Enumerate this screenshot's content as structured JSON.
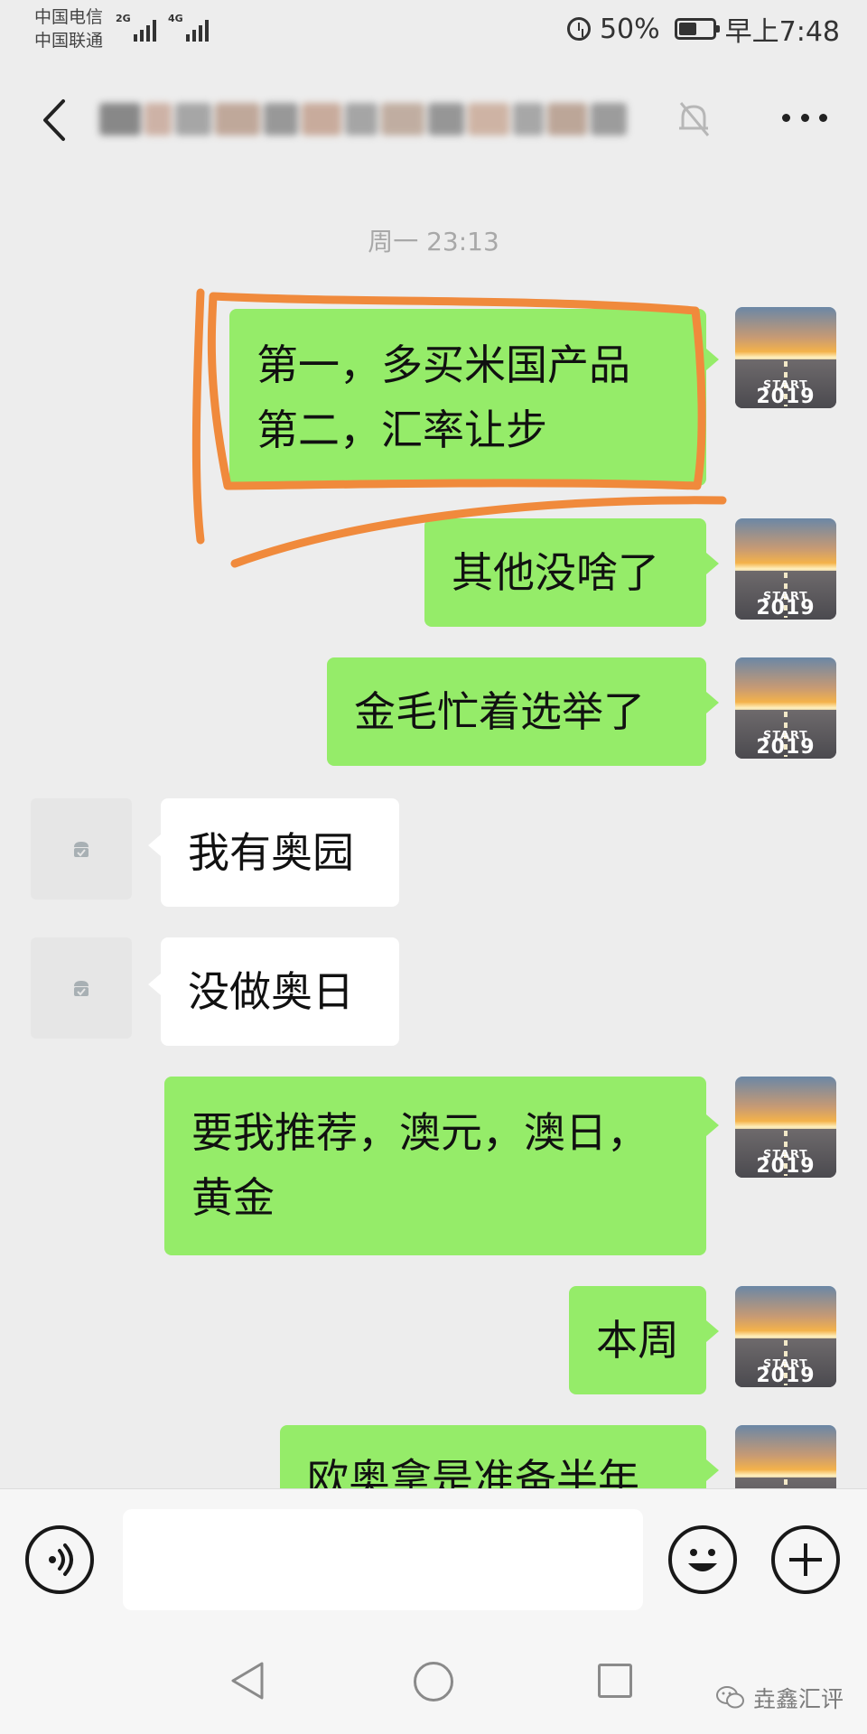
{
  "status_bar": {
    "carrier_1": "中国电信",
    "carrier_2": "中国联通",
    "net_1": "2G",
    "net_2": "4G",
    "battery": "50%",
    "time": "早上7:48",
    "icons": [
      "alarm-icon",
      "battery-icon",
      "signal-icon"
    ]
  },
  "header": {
    "title": "",
    "icons": [
      "back-icon",
      "mute-icon",
      "more-icon"
    ]
  },
  "chat": {
    "timestamp": "周一 23:13",
    "messages": [
      {
        "side": "self",
        "lines": [
          "第一，多买米国产品",
          "第二，汇率让步"
        ]
      },
      {
        "side": "self",
        "lines": [
          "其他没啥了"
        ]
      },
      {
        "side": "self",
        "lines": [
          "金毛忙着选举了"
        ]
      },
      {
        "side": "other",
        "lines": [
          "我有奥园"
        ]
      },
      {
        "side": "other",
        "lines": [
          "没做奥日"
        ]
      },
      {
        "side": "self",
        "lines": [
          "要我推荐，澳元，澳日，",
          "黄金"
        ]
      },
      {
        "side": "self",
        "lines": [
          "本周"
        ]
      },
      {
        "side": "self",
        "lines": [
          "欧奥拿是准备半年"
        ]
      }
    ],
    "self_avatar": {
      "text_top": "START",
      "text_bottom": "2019"
    },
    "colors": {
      "self_bubble": "#95ec69",
      "other_bubble": "#ffffff",
      "highlight": "#f08a3c",
      "background": "#ededed"
    }
  },
  "input_bar": {
    "placeholder": "",
    "icons": [
      "voice-icon",
      "emoji-icon",
      "plus-icon"
    ]
  },
  "system_nav": {
    "icons": [
      "nav-back-icon",
      "nav-home-icon",
      "nav-recent-icon"
    ]
  },
  "watermark": {
    "text": "垚鑫汇评"
  }
}
